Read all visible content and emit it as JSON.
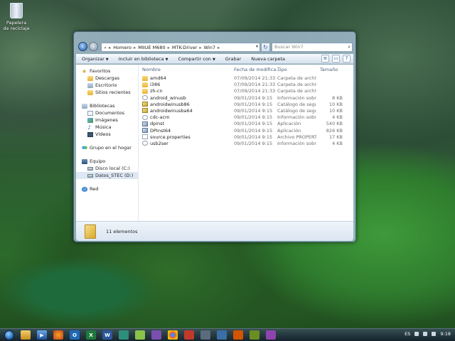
{
  "desktop": {
    "recycle_bin_label": "Papelera de reciclaje"
  },
  "window": {
    "breadcrumb": [
      "Homero",
      "MIIUE M680",
      "MTK-Driver",
      "Win7"
    ],
    "search_placeholder": "Buscar Win7",
    "toolbar": {
      "organize": "Organizar",
      "include": "Incluir en biblioteca",
      "share": "Compartir con",
      "burn": "Grabar",
      "new_folder": "Nueva carpeta"
    },
    "sidebar": {
      "favorites": "Favoritos",
      "downloads": "Descargas",
      "desktop": "Escritorio",
      "recent": "Sitios recientes",
      "libraries": "Bibliotecas",
      "documents": "Documentos",
      "images": "Imágenes",
      "music": "Música",
      "videos": "Vídeos",
      "homegroup": "Grupo en el hogar",
      "computer": "Equipo",
      "local_disk": "Disco local (C:)",
      "data_disk": "Datos_STEC (D:)",
      "network": "Red"
    },
    "columns": {
      "name": "Nombre",
      "date": "Fecha de modifica...",
      "type": "Tipo",
      "size": "Tamaño"
    },
    "files": [
      {
        "icon": "folder",
        "name": "amd64",
        "date": "07/09/2014 21:33",
        "type": "Carpeta de archivos",
        "size": ""
      },
      {
        "icon": "folder",
        "name": "i386",
        "date": "07/09/2014 21:33",
        "type": "Carpeta de archivos",
        "size": ""
      },
      {
        "icon": "folder",
        "name": "zh-cn",
        "date": "07/09/2014 21:33",
        "type": "Carpeta de archivos",
        "size": ""
      },
      {
        "icon": "inf",
        "name": "android_winusb",
        "date": "09/01/2014 9:15",
        "type": "Información sobre...",
        "size": "8 KB"
      },
      {
        "icon": "cat",
        "name": "androidwinusb86",
        "date": "09/01/2014 9:15",
        "type": "Catálogo de segur...",
        "size": "10 KB"
      },
      {
        "icon": "cat",
        "name": "androidwinusba64",
        "date": "09/01/2014 9:15",
        "type": "Catálogo de segur...",
        "size": "10 KB"
      },
      {
        "icon": "inf",
        "name": "cdc-acm",
        "date": "09/01/2014 9:15",
        "type": "Información sobre...",
        "size": "4 KB"
      },
      {
        "icon": "app",
        "name": "dpinst",
        "date": "09/01/2014 9:15",
        "type": "Aplicación",
        "size": "540 KB"
      },
      {
        "icon": "app",
        "name": "DPInst64",
        "date": "09/01/2014 9:15",
        "type": "Aplicación",
        "size": "826 KB"
      },
      {
        "icon": "txt",
        "name": "source.properties",
        "date": "09/01/2014 9:15",
        "type": "Archivo PROPERTI...",
        "size": "17 KB"
      },
      {
        "icon": "inf",
        "name": "usb2ser",
        "date": "09/01/2014 9:15",
        "type": "Información sobre...",
        "size": "4 KB"
      }
    ],
    "status_text": "11 elementos"
  },
  "taskbar": {
    "language": "ES",
    "clock": "9:18"
  }
}
